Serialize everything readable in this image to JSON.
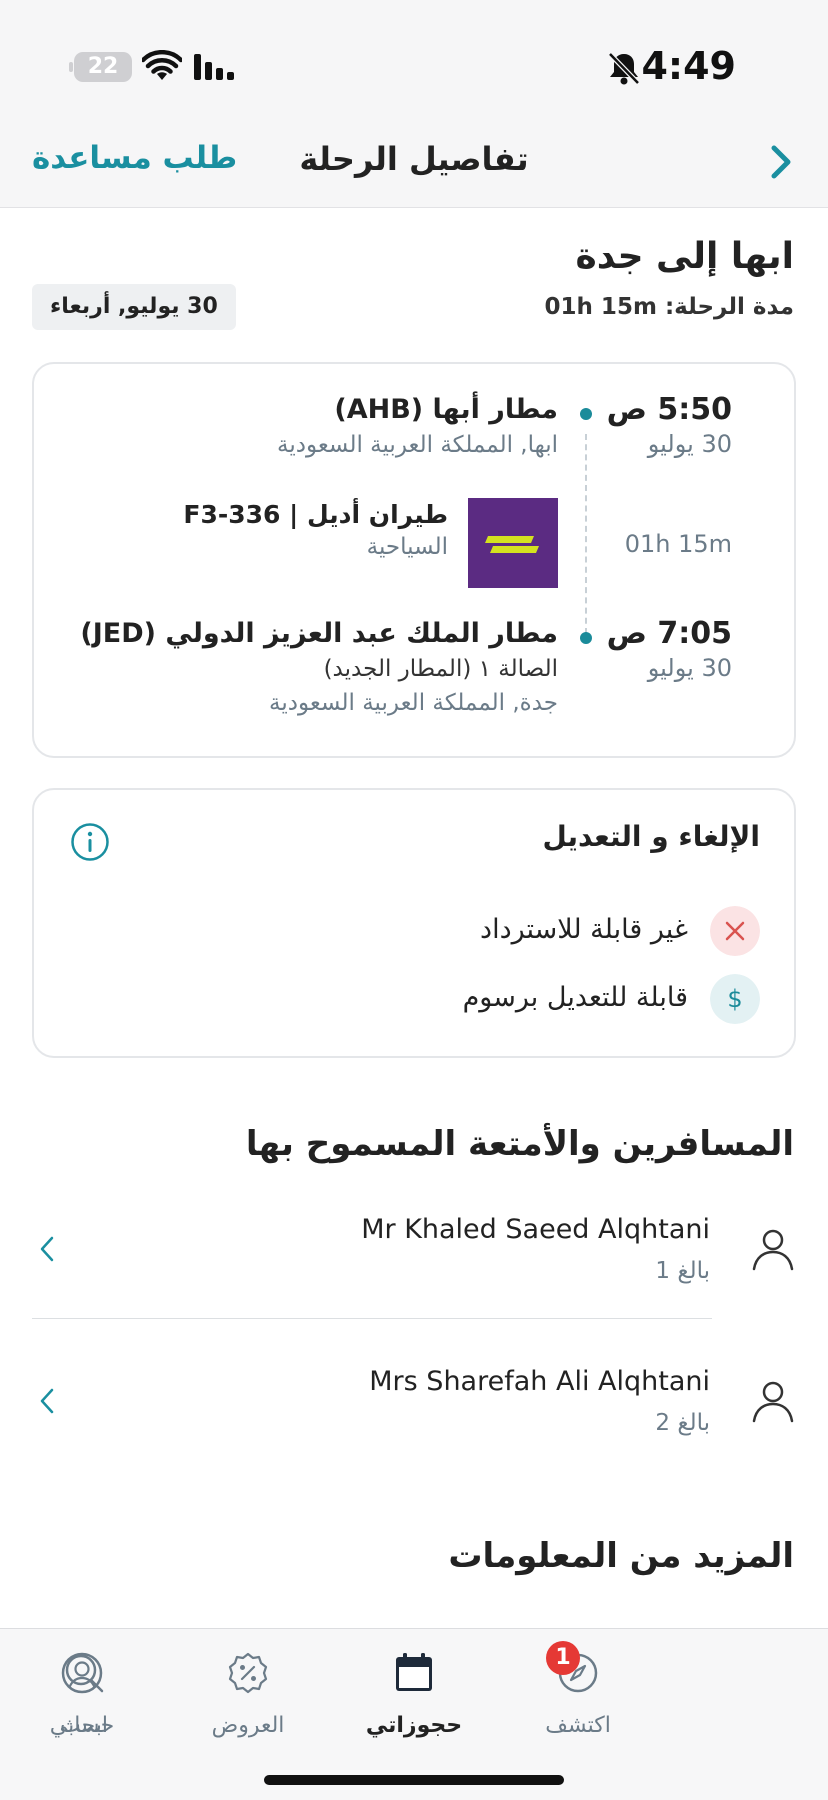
{
  "status_bar": {
    "time": "4:49",
    "battery": "22"
  },
  "header": {
    "title": "تفاصيل الرحلة",
    "help_label": "طلب مساعدة"
  },
  "trip": {
    "title": "ابها إلى جدة",
    "duration_label": "مدة الرحلة:",
    "duration": "01h 15m",
    "date": "30 يوليو, أربعاء"
  },
  "flight": {
    "departure": {
      "time": "5:50 ص",
      "date": "30 يوليو",
      "airport": "مطار أبها (AHB)",
      "location": "ابها, المملكة العربية السعودية"
    },
    "segment_duration": "01h 15m",
    "airline": {
      "name": "طيران أديل | F3-336",
      "cabin": "السياحية"
    },
    "arrival": {
      "time": "7:05 ص",
      "date": "30 يوليو",
      "airport": "مطار الملك عبد العزيز الدولي (JED)",
      "terminal": "الصالة ١ (المطار الجديد)",
      "location": "جدة, المملكة العربية السعودية"
    }
  },
  "cancellation": {
    "title": "الإلغاء و التعديل",
    "items": [
      {
        "text": "غير قابلة للاسترداد",
        "icon": "x-icon",
        "color": "#d9534f"
      },
      {
        "text": "قابلة للتعديل برسوم",
        "icon": "dollar-icon",
        "color": "#1b8b9a"
      }
    ]
  },
  "passengers_section": {
    "title": "المسافرين والأمتعة المسموح بها",
    "items": [
      {
        "name": "Mr Khaled Saeed Alqhtani",
        "type": "بالغ 1"
      },
      {
        "name": "Mrs Sharefah Ali Alqhtani",
        "type": "بالغ 2"
      }
    ]
  },
  "more_info": {
    "title": "المزيد من المعلومات"
  },
  "tabs": [
    {
      "label": "ابحث",
      "icon": "search-icon"
    },
    {
      "label": "اكتشف",
      "icon": "compass-icon",
      "badge": "1"
    },
    {
      "label": "حجوزاتي",
      "icon": "calendar-icon",
      "active": true
    },
    {
      "label": "العروض",
      "icon": "discount-icon"
    },
    {
      "label": "حسابي",
      "icon": "profile-icon"
    }
  ],
  "colors": {
    "accent": "#1a8fa0",
    "airline_brand": "#5b2b82",
    "airline_mark": "#d4e21f"
  }
}
